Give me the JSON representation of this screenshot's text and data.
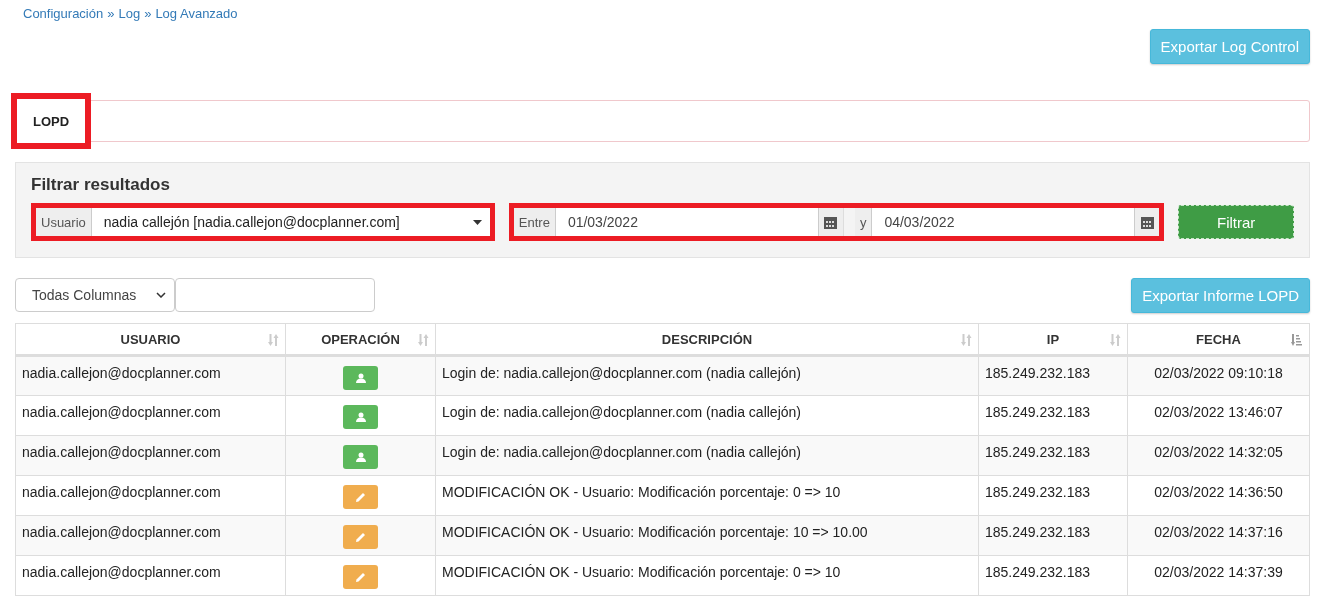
{
  "breadcrumb": [
    {
      "label": "Configuración"
    },
    {
      "label": "Log"
    },
    {
      "label": "Log Avanzado"
    }
  ],
  "breadcrumb_separator": "»",
  "export_control_button": "Exportar Log Control",
  "tabs": [
    {
      "label": "LOPD",
      "selected": true,
      "highlighted": true
    }
  ],
  "filter": {
    "title": "Filtrar resultados",
    "user": {
      "label": "Usuario",
      "value": "nadia callejón [nadia.callejon@docplanner.com]",
      "highlighted": true
    },
    "dates": {
      "from_label": "Entre",
      "from": "01/03/2022",
      "to_label": "y",
      "to": "04/03/2022",
      "highlighted": true
    },
    "button": "Filtrar"
  },
  "column_select": "Todas Columnas",
  "export_report_button": "Exportar Informe LOPD",
  "table": {
    "columns": [
      {
        "label": "USUARIO",
        "sorted": false
      },
      {
        "label": "OPERACIÓN",
        "sorted": false
      },
      {
        "label": "DESCRIPCIÓN",
        "sorted": false
      },
      {
        "label": "IP",
        "sorted": false
      },
      {
        "label": "FECHA",
        "sorted": true
      }
    ],
    "rows": [
      {
        "user": "nadia.callejon@docplanner.com",
        "kind": "login",
        "description": "Login de: nadia.callejon@docplanner.com (nadia callejón)",
        "ip": "185.249.232.183",
        "date": "02/03/2022 09:10:18"
      },
      {
        "user": "nadia.callejon@docplanner.com",
        "kind": "login",
        "description": "Login de: nadia.callejon@docplanner.com (nadia callejón)",
        "ip": "185.249.232.183",
        "date": "02/03/2022 13:46:07"
      },
      {
        "user": "nadia.callejon@docplanner.com",
        "kind": "login",
        "description": "Login de: nadia.callejon@docplanner.com (nadia callejón)",
        "ip": "185.249.232.183",
        "date": "02/03/2022 14:32:05"
      },
      {
        "user": "nadia.callejon@docplanner.com",
        "kind": "edit",
        "description": "MODIFICACIÓN OK - Usuario: Modificación porcentaje: 0 => 10",
        "ip": "185.249.232.183",
        "date": "02/03/2022 14:36:50"
      },
      {
        "user": "nadia.callejon@docplanner.com",
        "kind": "edit",
        "description": "MODIFICACIÓN OK - Usuario: Modificación porcentaje: 10 => 10.00",
        "ip": "185.249.232.183",
        "date": "02/03/2022 14:37:16"
      },
      {
        "user": "nadia.callejon@docplanner.com",
        "kind": "edit",
        "description": "MODIFICACIÓN OK - Usuario: Modificación porcentaje: 0 => 10",
        "ip": "185.249.232.183",
        "date": "02/03/2022 14:37:39"
      }
    ]
  }
}
